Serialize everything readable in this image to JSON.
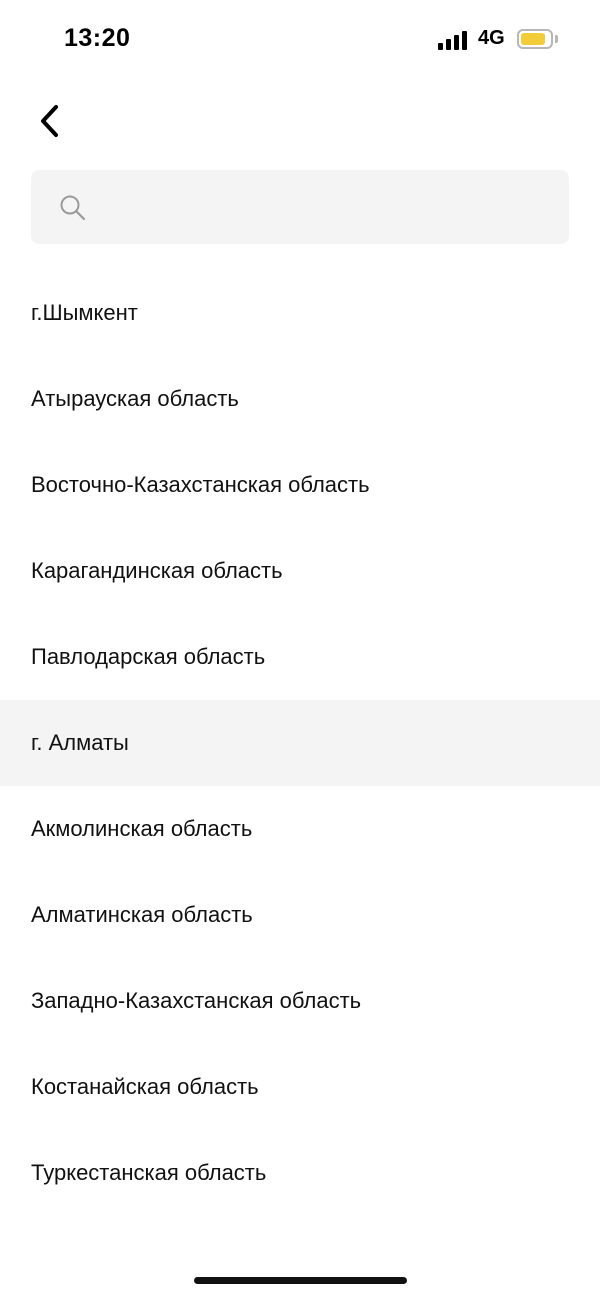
{
  "status_bar": {
    "time": "13:20",
    "network": "4G",
    "signal_bars": 4,
    "battery_level": 0.8,
    "battery_color": "#f3cc3a"
  },
  "header": {
    "back_icon": "chevron-left-icon"
  },
  "search": {
    "icon": "search-icon",
    "placeholder": "",
    "value": ""
  },
  "regions": {
    "selected_index": 5,
    "items": [
      {
        "label": "г.Шымкент"
      },
      {
        "label": "Атырауская область"
      },
      {
        "label": "Восточно-Казахстанская область"
      },
      {
        "label": "Карагандинская область"
      },
      {
        "label": "Павлодарская область"
      },
      {
        "label": "г. Алматы"
      },
      {
        "label": "Акмолинская область"
      },
      {
        "label": "Алматинская область"
      },
      {
        "label": "Западно-Казахстанская область"
      },
      {
        "label": "Костанайская область"
      },
      {
        "label": "Туркестанская область"
      }
    ]
  },
  "colors": {
    "search_background": "#f4f4f4",
    "selected_row_background": "#f4f4f4",
    "text": "#111111"
  }
}
